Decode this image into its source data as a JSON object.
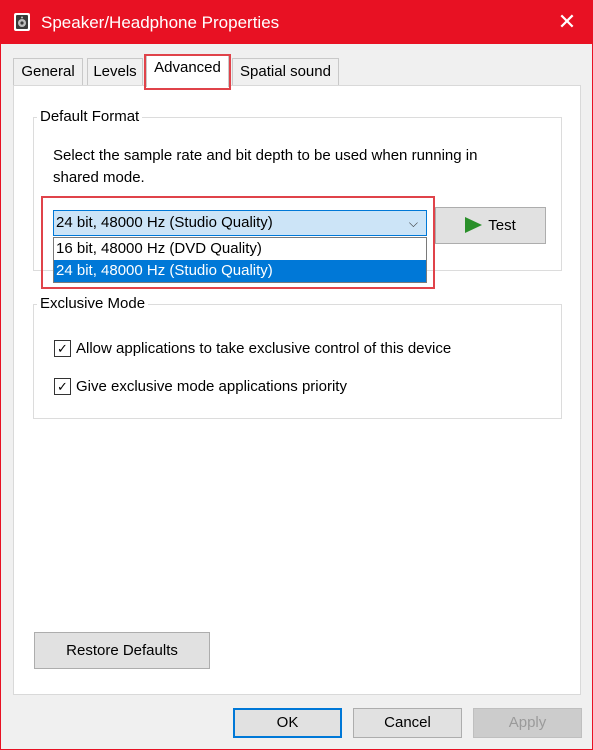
{
  "window": {
    "title": "Speaker/Headphone Properties",
    "close_glyph": "✕",
    "accent_color": "#e81123"
  },
  "tabs": [
    {
      "label": "General",
      "active": false
    },
    {
      "label": "Levels",
      "active": false
    },
    {
      "label": "Advanced",
      "active": true
    },
    {
      "label": "Spatial sound",
      "active": false
    }
  ],
  "default_format": {
    "group_label": "Default Format",
    "description": "Select the sample rate and bit depth to be used when running in shared mode.",
    "selected_value": "24 bit, 48000 Hz (Studio Quality)",
    "options": [
      {
        "label": "16 bit, 48000 Hz (DVD Quality)",
        "selected": false
      },
      {
        "label": "24 bit, 48000 Hz (Studio Quality)",
        "selected": true
      }
    ],
    "test_button": "Test"
  },
  "exclusive_mode": {
    "group_label": "Exclusive Mode",
    "checkboxes": [
      {
        "label": "Allow applications to take exclusive control of this device",
        "checked": true
      },
      {
        "label": "Give exclusive mode applications priority",
        "checked": true
      }
    ]
  },
  "footer": {
    "restore_defaults": "Restore Defaults",
    "ok": "OK",
    "cancel": "Cancel",
    "apply": "Apply"
  },
  "icons": {
    "check": "✓",
    "dropdown_arrow": "⌵"
  },
  "colors": {
    "selection_blue": "#0078d7",
    "highlight_red": "#e0434a",
    "play_green": "#2a8f2a"
  }
}
